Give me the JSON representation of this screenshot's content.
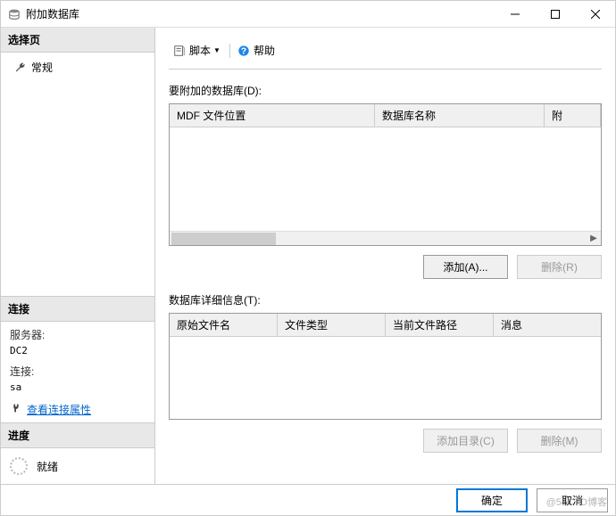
{
  "window": {
    "title": "附加数据库"
  },
  "left": {
    "select_page_header": "选择页",
    "general_item": "常规",
    "connection_header": "连接",
    "server_label": "服务器:",
    "server_value": "DC2",
    "conn_label": "连接:",
    "conn_value": "sa",
    "view_props_link": "查看连接属性",
    "progress_header": "进度",
    "progress_status": "就绪"
  },
  "toolbar": {
    "script_label": "脚本",
    "help_label": "帮助"
  },
  "top_section": {
    "label": "要附加的数据库(D):",
    "columns": {
      "mdf_location": "MDF 文件位置",
      "db_name": "数据库名称",
      "attach": "附"
    },
    "add_btn": "添加(A)...",
    "remove_btn": "删除(R)"
  },
  "bottom_section": {
    "label": "数据库详细信息(T):",
    "columns": {
      "orig_filename": "原始文件名",
      "file_type": "文件类型",
      "current_path": "当前文件路径",
      "message": "消息"
    },
    "add_dir_btn": "添加目录(C)",
    "remove_btn": "删除(M)"
  },
  "dialog": {
    "ok": "确定",
    "cancel": "取消"
  },
  "watermark": "@51CTO博客"
}
